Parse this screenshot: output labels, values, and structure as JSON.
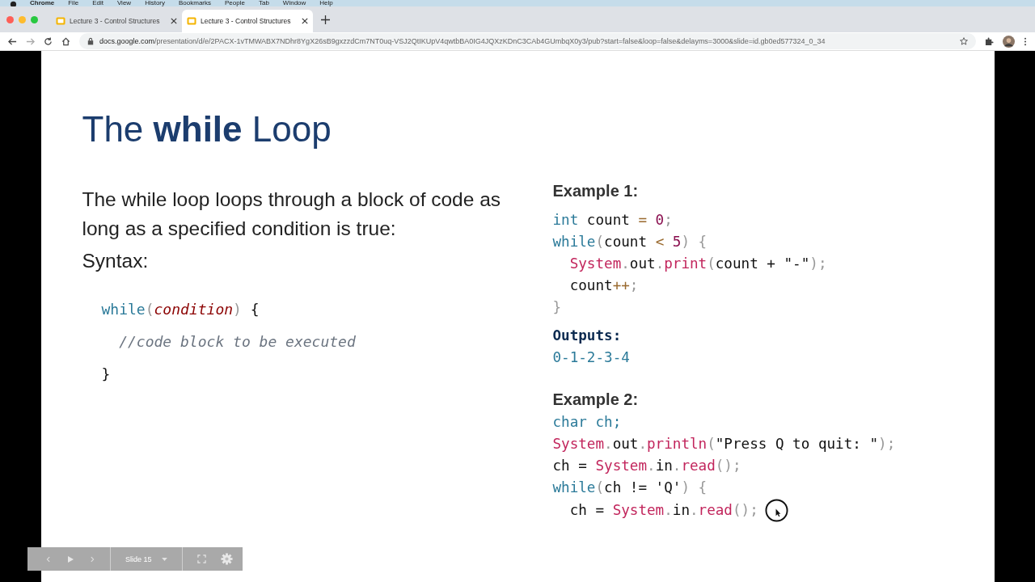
{
  "menu_bar": [
    "Chrome",
    "File",
    "Edit",
    "View",
    "History",
    "Bookmarks",
    "People",
    "Tab",
    "Window",
    "Help"
  ],
  "tabs": [
    {
      "title": "Lecture 3 - Control Structures",
      "selected": false
    },
    {
      "title": "Lecture 3 - Control Structures",
      "selected": true
    }
  ],
  "address_bar": {
    "host": "docs.google.com",
    "path": "/presentation/d/e/2PACX-1vTMWABX7NDhr8YgX26sB9gxzzdCm7NT0uq-VSJ2QtIKUpV4qwtbBA0IG4JQXzKDnC3CAb4GUmbqX0y3/pub?start=false&loop=false&delayms=3000&slide=id.gb0ed577324_0_34"
  },
  "slide": {
    "title": "The **while** Loop",
    "intro": "The while loop loops through a block of code as long as a specified condition is true:",
    "syntax_label": "Syntax:",
    "syntax_code": [
      [
        {
          "text": "while",
          "kind": "keyword"
        },
        {
          "text": "(",
          "kind": "punct"
        },
        {
          "text": "condition",
          "kind": "param"
        },
        {
          "text": ")",
          "kind": "punct"
        },
        {
          "text": " {",
          "kind": "plain"
        }
      ],
      [
        {
          "text": "  //code block to be executed",
          "kind": "comment"
        }
      ],
      [
        {
          "text": "}",
          "kind": "plain"
        }
      ]
    ],
    "example_1": {
      "heading": "Example 1:",
      "code": [
        [
          {
            "text": "int",
            "kind": "keyword"
          },
          {
            "text": " count ",
            "kind": "plain"
          },
          {
            "text": "=",
            "kind": "operator"
          },
          {
            "text": " 0",
            "kind": "number"
          },
          {
            "text": ";",
            "kind": "punct"
          }
        ],
        [
          {
            "text": "while",
            "kind": "keyword"
          },
          {
            "text": "(",
            "kind": "punct"
          },
          {
            "text": "count ",
            "kind": "plain"
          },
          {
            "text": "<",
            "kind": "operator"
          },
          {
            "text": " 5",
            "kind": "number"
          },
          {
            "text": ") {",
            "kind": "punct"
          }
        ],
        [
          {
            "text": "  System",
            "kind": "class"
          },
          {
            "text": ".",
            "kind": "punct"
          },
          {
            "text": "out",
            "kind": "plain"
          },
          {
            "text": ".",
            "kind": "punct"
          },
          {
            "text": "print",
            "kind": "class"
          },
          {
            "text": "(",
            "kind": "punct"
          },
          {
            "text": "count + \"-\"",
            "kind": "plain"
          },
          {
            "text": ");",
            "kind": "punct"
          }
        ],
        [
          {
            "text": "  count",
            "kind": "plain"
          },
          {
            "text": "++",
            "kind": "operator"
          },
          {
            "text": ";",
            "kind": "punct"
          }
        ],
        [
          {
            "text": "}",
            "kind": "punct"
          }
        ]
      ],
      "outputs_label": "Outputs:",
      "output": "0-1-2-3-4"
    },
    "example_2": {
      "heading": "Example 2:",
      "code": [
        [
          {
            "text": "char ch;",
            "kind": "keyword"
          }
        ],
        [
          {
            "text": "System",
            "kind": "class"
          },
          {
            "text": ".",
            "kind": "punct"
          },
          {
            "text": "out",
            "kind": "plain"
          },
          {
            "text": ".",
            "kind": "punct"
          },
          {
            "text": "println",
            "kind": "class"
          },
          {
            "text": "(",
            "kind": "punct"
          },
          {
            "text": "\"Press Q to quit: \"",
            "kind": "plain"
          },
          {
            "text": ");",
            "kind": "punct"
          }
        ],
        [
          {
            "text": "ch = ",
            "kind": "plain"
          },
          {
            "text": "System",
            "kind": "class"
          },
          {
            "text": ".",
            "kind": "punct"
          },
          {
            "text": "in",
            "kind": "plain"
          },
          {
            "text": ".",
            "kind": "punct"
          },
          {
            "text": "read",
            "kind": "class"
          },
          {
            "text": "();",
            "kind": "punct"
          }
        ],
        [
          {
            "text": "while",
            "kind": "keyword"
          },
          {
            "text": "(",
            "kind": "punct"
          },
          {
            "text": "ch != 'Q'",
            "kind": "plain"
          },
          {
            "text": ") {",
            "kind": "punct"
          }
        ],
        [
          {
            "text": "  ch = ",
            "kind": "plain"
          },
          {
            "text": "System",
            "kind": "class"
          },
          {
            "text": ".",
            "kind": "punct"
          },
          {
            "text": "in",
            "kind": "plain"
          },
          {
            "text": ".",
            "kind": "punct"
          },
          {
            "text": "read",
            "kind": "class"
          },
          {
            "text": "();",
            "kind": "punct"
          }
        ]
      ]
    }
  },
  "slide_controls": {
    "slide_label": "Slide 15"
  }
}
